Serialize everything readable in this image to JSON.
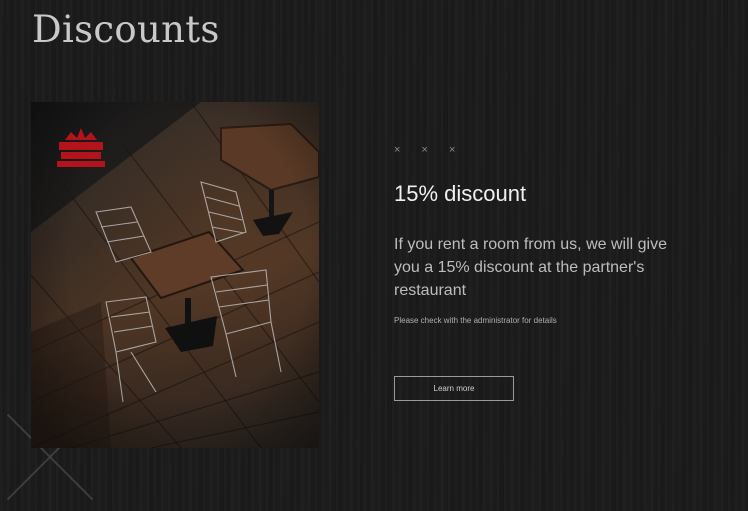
{
  "page": {
    "title": "Discounts"
  },
  "offer": {
    "stars": "× × ×",
    "title": "15% discount",
    "description": "If you rent a room from us, we will give you a 15% discount at the partner's restaurant",
    "note": "Please check with the administrator for details",
    "button_label": "Learn more"
  },
  "image": {
    "subject": "restaurant-tables-photo",
    "logo": "red restaurant logo"
  },
  "colors": {
    "background": "#1a1a1a",
    "title": "#c9c9c9",
    "logo_red": "#b3141b"
  }
}
